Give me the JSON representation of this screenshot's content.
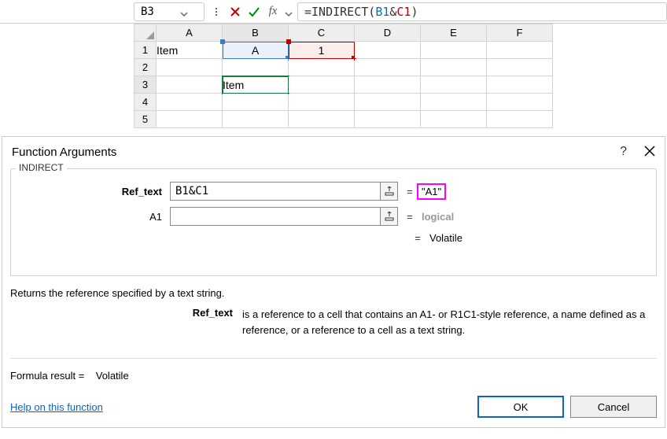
{
  "formula_bar": {
    "name_box": "B3",
    "formula_prefix": "=",
    "formula_fn": "INDIRECT",
    "arg_b1": "B1",
    "arg_amp": "&",
    "arg_c1": "C1"
  },
  "sheet": {
    "cols": [
      "A",
      "B",
      "C",
      "D",
      "E",
      "F"
    ],
    "rows": [
      "1",
      "2",
      "3",
      "4",
      "5"
    ],
    "a1": "Item",
    "b1": "A",
    "c1": "1",
    "b3": "Item"
  },
  "dialog": {
    "title": "Function Arguments",
    "legend": "INDIRECT",
    "arg1_label": "Ref_text",
    "arg1_value": "B1&C1",
    "arg1_result": "\"A1\"",
    "arg2_label": "A1",
    "arg2_value": "",
    "arg2_result": "logical",
    "eq_sign": "=",
    "volatile": "Volatile",
    "desc1": "Returns the reference specified by a text string.",
    "desc2_label": "Ref_text",
    "desc2_text": "is a reference to a cell that contains an A1- or R1C1-style reference, a name defined as a reference, or a reference to a cell as a text string.",
    "formula_result_label": "Formula result =",
    "formula_result_value": "Volatile",
    "help_link": "Help on this function",
    "ok": "OK",
    "cancel": "Cancel"
  }
}
